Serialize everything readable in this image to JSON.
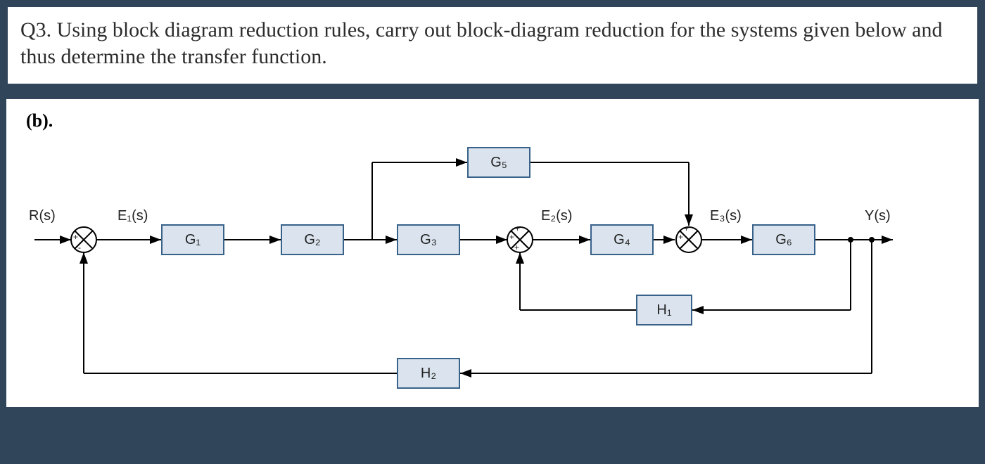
{
  "question": {
    "number": "Q3.",
    "text": "Using block diagram reduction rules, carry out block-diagram reduction for the systems given below and thus determine the transfer function."
  },
  "part_label": "(b).",
  "signals": {
    "input": "R(s)",
    "e1": "E₁(s)",
    "e2": "E₂(s)",
    "e3": "E₃(s)",
    "output": "Y(s)"
  },
  "blocks": {
    "g1": "G₁",
    "g2": "G₂",
    "g3": "G₃",
    "g4": "G₄",
    "g5": "G₅",
    "g6": "G₆",
    "h1": "H₁",
    "h2": "H₂"
  },
  "summing_junctions": {
    "s1": {
      "top": "",
      "left": "+",
      "bottom": "-"
    },
    "s2": {
      "top": "+",
      "left": "+",
      "bottom": "+"
    },
    "s3": {
      "top": "+",
      "left": "+",
      "bottom": ""
    }
  },
  "connections_description": [
    "R(s) -> S1(+)",
    "S1 -> E1(s) -> G1 -> G2 -> branch",
    "branch -> G3 -> S2(+)",
    "branch -> G5 -> S3(+)",
    "S2 -> E2(s) -> G4 -> S3(+)",
    "S3 -> E3(s) -> G6 -> Y(s)",
    "G6 output node -> H1 -> S2(+)",
    "G6 output node -> H2 -> S1(-)"
  ]
}
